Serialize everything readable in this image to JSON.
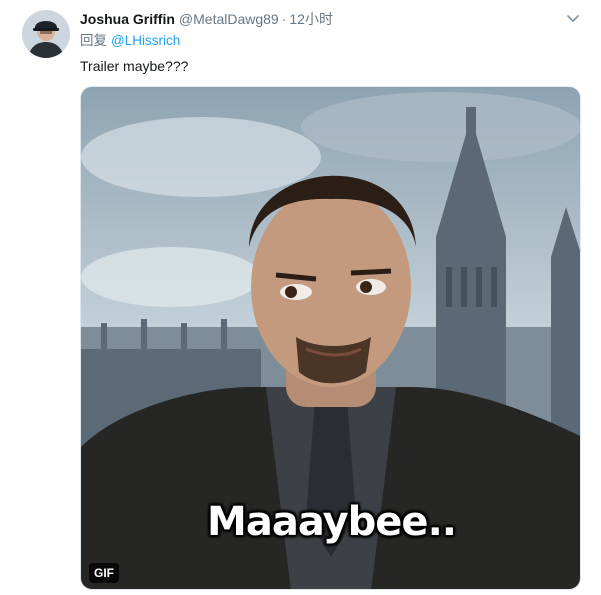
{
  "tweet": {
    "display_name": "Joshua Griffin",
    "handle": "@MetalDawg89",
    "separator": "·",
    "time": "12小时",
    "reply_prefix": "回复",
    "reply_mention": "@LHissrich",
    "text": "Trailer maybe???",
    "media": {
      "caption": "Maaaybee..",
      "badge": "GIF"
    }
  },
  "icons": {
    "more": "chevron-down-icon",
    "avatar": "avatar-image"
  },
  "colors": {
    "link": "#1da1f2",
    "secondary_text": "#657786",
    "primary_text": "#14171a"
  }
}
